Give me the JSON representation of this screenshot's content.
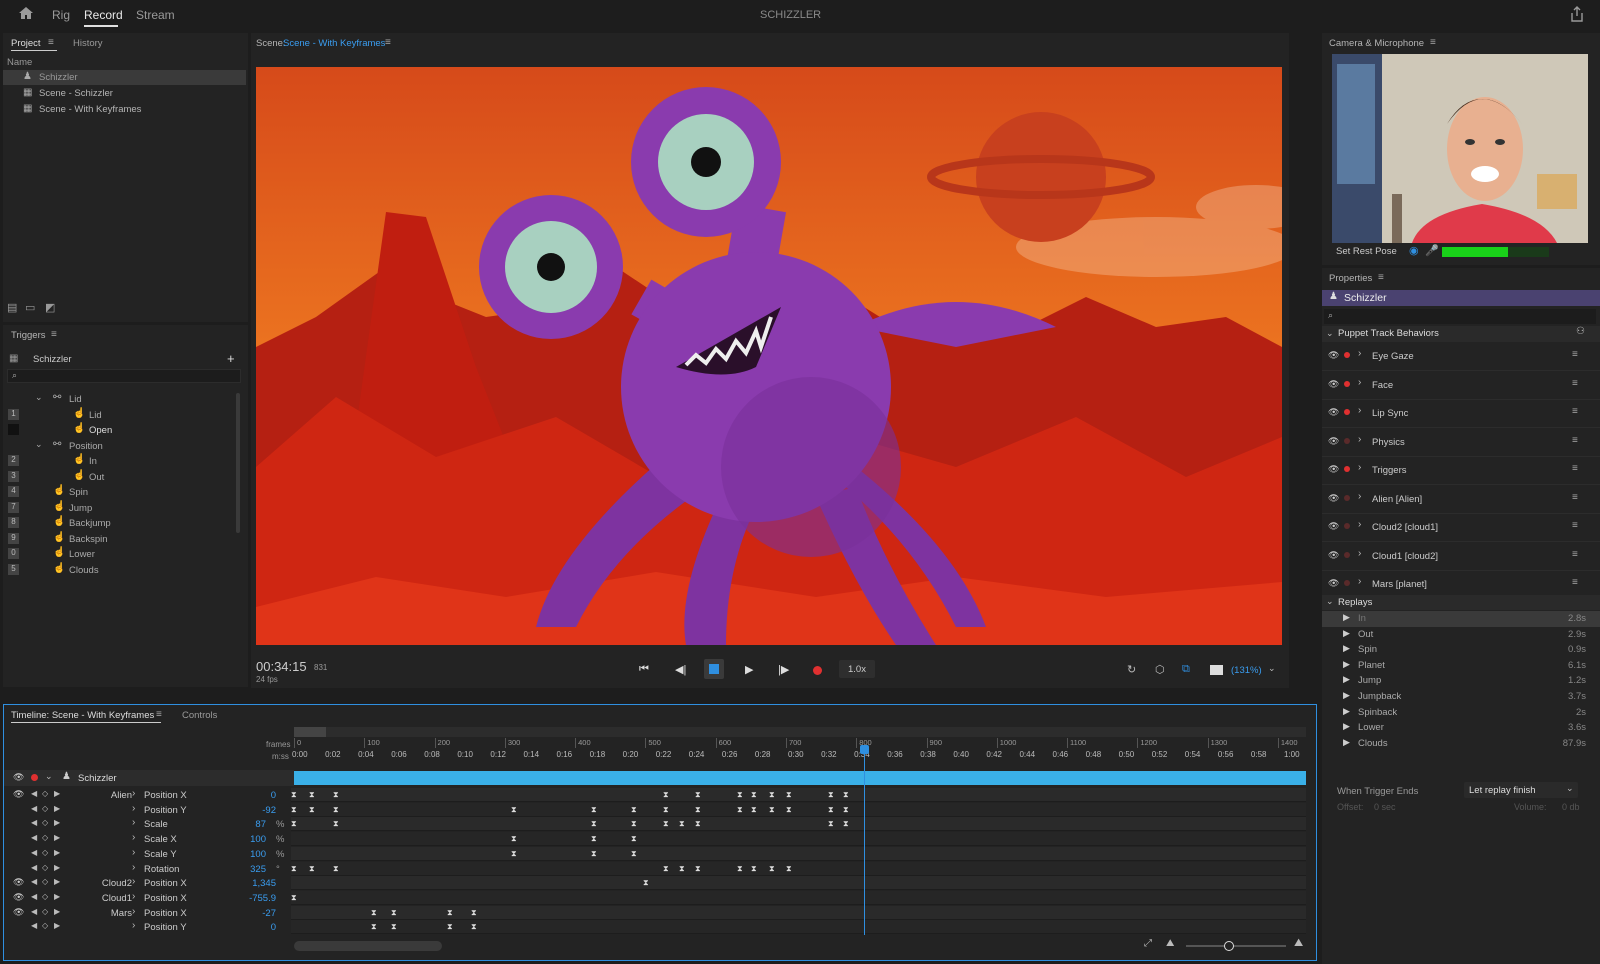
{
  "app": {
    "title": "SCHIZZLER",
    "tabs": [
      "Rig",
      "Record",
      "Stream"
    ],
    "active_tab": "Record"
  },
  "project": {
    "tabs": [
      "Project",
      "History"
    ],
    "column": "Name",
    "items": [
      "Schizzler",
      "Scene - Schizzler",
      "Scene - With Keyframes"
    ]
  },
  "triggers": {
    "title": "Triggers",
    "puppet": "Schizzler",
    "items": [
      {
        "key": "",
        "label": "Lid",
        "level": 0,
        "group": true
      },
      {
        "key": "1",
        "label": "Lid",
        "level": 1
      },
      {
        "key": "",
        "label": "Open",
        "level": 1
      },
      {
        "key": "",
        "label": "Position",
        "level": 0,
        "group": true
      },
      {
        "key": "2",
        "label": "In",
        "level": 1
      },
      {
        "key": "3",
        "label": "Out",
        "level": 1
      },
      {
        "key": "4",
        "label": "Spin",
        "level": 0
      },
      {
        "key": "7",
        "label": "Jump",
        "level": 0
      },
      {
        "key": "8",
        "label": "Backjump",
        "level": 0
      },
      {
        "key": "9",
        "label": "Backspin",
        "level": 0
      },
      {
        "key": "0",
        "label": "Lower",
        "level": 0
      },
      {
        "key": "5",
        "label": "Clouds",
        "level": 0
      }
    ]
  },
  "scene": {
    "prefix": "Scene:",
    "name": "Scene - With Keyframes"
  },
  "transport": {
    "timecode": "00:34:15",
    "frame": "831",
    "fps": "24 fps",
    "speed": "1.0x",
    "zoom": "(131%)"
  },
  "camera": {
    "title": "Camera & Microphone",
    "rest_pose": "Set Rest Pose",
    "mic_level": 0.62
  },
  "properties": {
    "title": "Properties",
    "puppet": "Schizzler",
    "group": "Puppet Track Behaviors",
    "behaviors": [
      {
        "name": "Eye Gaze",
        "armed": true
      },
      {
        "name": "Face",
        "armed": true
      },
      {
        "name": "Lip Sync",
        "armed": true
      },
      {
        "name": "Physics",
        "armed": false
      },
      {
        "name": "Triggers",
        "armed": true
      },
      {
        "name": "Alien [Alien]",
        "armed": false
      },
      {
        "name": "Cloud2 [cloud1]",
        "armed": false
      },
      {
        "name": "Cloud1 [cloud2]",
        "armed": false
      },
      {
        "name": "Mars [planet]",
        "armed": false
      }
    ],
    "replays_title": "Replays",
    "replays": [
      {
        "name": "In",
        "dur": "2.8s"
      },
      {
        "name": "Out",
        "dur": "2.9s"
      },
      {
        "name": "Spin",
        "dur": "0.9s"
      },
      {
        "name": "Planet",
        "dur": "6.1s"
      },
      {
        "name": "Jump",
        "dur": "1.2s"
      },
      {
        "name": "Jumpback",
        "dur": "3.7s"
      },
      {
        "name": "Spinback",
        "dur": "2s"
      },
      {
        "name": "Lower",
        "dur": "3.6s"
      },
      {
        "name": "Clouds",
        "dur": "87.9s"
      }
    ],
    "trigger_end_label": "When Trigger Ends",
    "trigger_end_value": "Let replay finish",
    "offset_label": "Offset:",
    "offset_value": "0 sec",
    "volume_label": "Volume:",
    "volume_value": "0 db"
  },
  "timeline": {
    "tabs": [
      "Timeline: Scene - With Keyframes",
      "Controls"
    ],
    "frames_label": "frames",
    "mss_label": "m:ss",
    "frame_ticks": [
      "0",
      "100",
      "200",
      "300",
      "400",
      "500",
      "600",
      "700",
      "800",
      "900",
      "1000",
      "1100",
      "1200",
      "1300",
      "1400"
    ],
    "time_ticks": [
      "0:00",
      "0:02",
      "0:04",
      "0:06",
      "0:08",
      "0:10",
      "0:12",
      "0:14",
      "0:16",
      "0:18",
      "0:20",
      "0:22",
      "0:24",
      "0:26",
      "0:28",
      "0:30",
      "0:32",
      "0:34",
      "0:36",
      "0:38",
      "0:40",
      "0:42",
      "0:44",
      "0:46",
      "0:48",
      "0:50",
      "0:52",
      "0:54",
      "0:56",
      "0:58",
      "1:00"
    ],
    "playhead_time": "0:34",
    "puppet": "Schizzler",
    "tracks": [
      {
        "group": "Alien",
        "param": "Position X",
        "value": "0",
        "unit": ""
      },
      {
        "group": "",
        "param": "Position Y",
        "value": "-92",
        "unit": ""
      },
      {
        "group": "",
        "param": "Scale",
        "value": "87",
        "unit": "%"
      },
      {
        "group": "",
        "param": "Scale X",
        "value": "100",
        "unit": "%"
      },
      {
        "group": "",
        "param": "Scale Y",
        "value": "100",
        "unit": "%"
      },
      {
        "group": "",
        "param": "Rotation",
        "value": "325",
        "unit": "°"
      },
      {
        "group": "Cloud2",
        "param": "Position X",
        "value": "1,345",
        "unit": ""
      },
      {
        "group": "Cloud1",
        "param": "Position X",
        "value": "-755.9",
        "unit": ""
      },
      {
        "group": "Mars",
        "param": "Position X",
        "value": "-27",
        "unit": ""
      },
      {
        "group": "",
        "param": "Position Y",
        "value": "0",
        "unit": ""
      }
    ]
  },
  "colors": {
    "accent": "#2f8fe0",
    "record": "#e03030",
    "puppet_bar": "#3ab0e8",
    "selected": "#4a4270"
  }
}
